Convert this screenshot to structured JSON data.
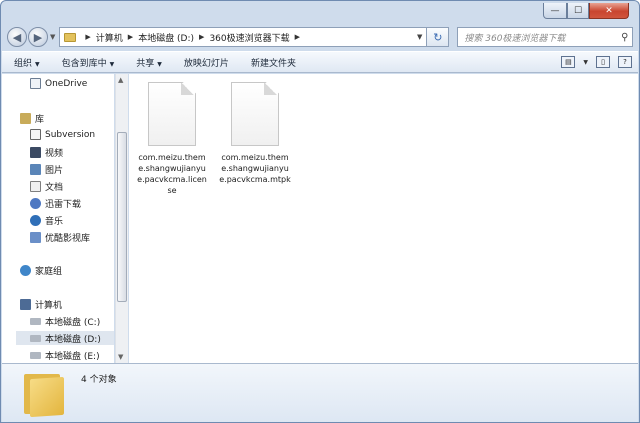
{
  "window": {
    "caption": {
      "minimize": "—",
      "maximize": "☐",
      "close": "✕"
    }
  },
  "address_bar": {
    "crumbs": [
      "计算机",
      "本地磁盘 (D:)",
      "360极速浏览器下载"
    ],
    "refresh": "↻"
  },
  "search": {
    "placeholder": "搜索 360极速浏览器下载",
    "icon": "search-icon"
  },
  "toolbar": {
    "organize": "组织",
    "include_in_library": "包含到库中",
    "share": "共享",
    "slideshow": "放映幻灯片",
    "new_folder": "新建文件夹"
  },
  "nav": {
    "onedrive": "OneDrive",
    "libraries": "库",
    "subversion": "Subversion",
    "videos": "视频",
    "pictures": "图片",
    "documents": "文档",
    "xunlei": "迅雷下载",
    "music": "音乐",
    "youku": "优酷影视库",
    "homegroup": "家庭组",
    "computer": "计算机",
    "drive_c": "本地磁盘 (C:)",
    "drive_d": "本地磁盘 (D:)",
    "drive_e": "本地磁盘 (E:)"
  },
  "files": [
    {
      "name": "com.meizu.theme.shangwujianyue.pacvkcma.license"
    },
    {
      "name": "com.meizu.theme.shangwujianyue.pacvkcma.mtpk"
    }
  ],
  "status": {
    "count": "4 个对象"
  },
  "colors": {
    "chrome": "#cfdcec",
    "folder": "#e3b53e",
    "close": "#c9452f"
  }
}
